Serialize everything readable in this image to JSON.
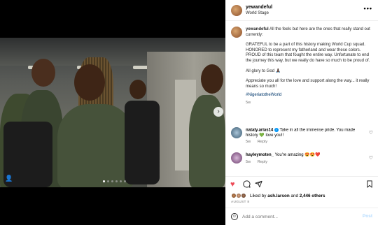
{
  "post": {
    "username": "yewandeful",
    "location": "World Stage"
  },
  "caption": {
    "username": "yewandeful",
    "intro": "All the feels but here are the ones that really stand out currently:",
    "para1": "GRATEFUL to be a part of this history making World Cup squad.\nHONORED to represent my fatherland and wear these colors.\nPROUD of this team that fought the entire way. Unfortunate to end the journey this way, but we really do have so much to be proud of.",
    "para2": "All glory to God 🙏🏿",
    "para3": "Appreciate you all for the love and support along the way... it really means so much!",
    "hashtag": "#NigeriatotheWorld",
    "age": "5w"
  },
  "comments": [
    {
      "username": "nataly.arias14",
      "text": "Take in all the immense pride. You made history 💚 love you!!",
      "age": "5w",
      "reply": "Reply"
    },
    {
      "username": "hayleymoten_",
      "text": "You're amazing 😍😍❤️",
      "age": "5w",
      "reply": "Reply"
    }
  ],
  "likes": {
    "prefix": "Liked by ",
    "user": "ash.larson",
    "mid": " and ",
    "others": "2,446 others"
  },
  "date": "AUGUST 8",
  "add_comment": {
    "placeholder": "Add a comment...",
    "post_label": "Post"
  },
  "icons": {
    "like": "heart-icon",
    "comment": "comment-icon",
    "share": "share-icon",
    "save": "bookmark-icon",
    "more": "more-icon",
    "emoji": "emoji-icon"
  },
  "colors": {
    "like_red": "#ed4956",
    "hashtag": "#00376b",
    "verified": "#0095f6"
  }
}
